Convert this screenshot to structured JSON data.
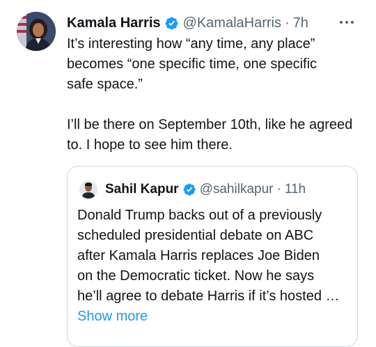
{
  "tweet": {
    "author_name": "Kamala Harris",
    "author_handle": "@KamalaHarris",
    "separator": "·",
    "time": "7h",
    "text_lines": [
      "It’s interesting how “any time, any place”",
      "becomes “one specific time, one specific",
      "safe space.”",
      "",
      "I’ll be there on September 10th, like he agreed",
      "to. I hope to see him there."
    ]
  },
  "quoted_tweet": {
    "author_name": "Sahil Kapur",
    "author_handle": "@sahilkapur",
    "separator": "·",
    "time": "11h",
    "text_lines": [
      "Donald Trump backs out of a previously",
      "scheduled presidential debate on ABC",
      "after Kamala Harris replaces Joe Biden",
      "on the Democratic ticket. Now he says",
      "he’ll agree to debate Harris if it’s hosted …"
    ],
    "show_more_label": "Show more"
  },
  "icons": {
    "verified": "verified-badge-icon",
    "more": "more-options-icon"
  },
  "colors": {
    "text": "#0f1419",
    "secondary": "#536471",
    "link": "#1d9bf0",
    "verified": "#1d9bf0",
    "border": "#cfd9de"
  }
}
